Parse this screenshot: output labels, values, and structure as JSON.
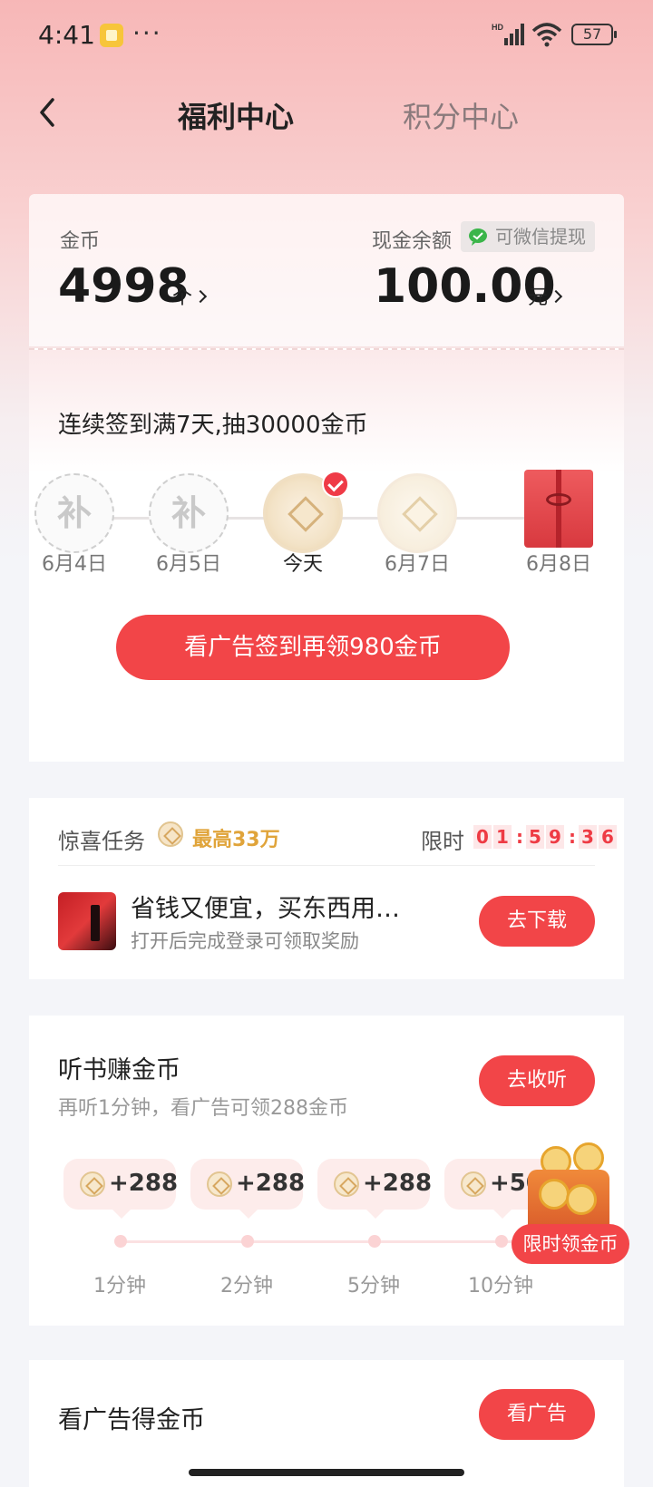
{
  "status_bar": {
    "time": "4:41",
    "more": "···",
    "battery": "57"
  },
  "header": {
    "tabs": [
      {
        "label": "福利中心",
        "active": true
      },
      {
        "label": "积分中心",
        "active": false
      }
    ]
  },
  "balance": {
    "coin_label": "金币",
    "coin_value": "4998",
    "coin_unit": "个",
    "cash_label": "现金余额",
    "wechat_badge": "可微信提现",
    "cash_value": "100.00",
    "cash_unit": "元"
  },
  "checkin": {
    "title": "连续签到满7天,抽30000金币",
    "days": [
      {
        "label": "6月4日",
        "state": "makeup",
        "glyph": "补"
      },
      {
        "label": "6月5日",
        "state": "makeup",
        "glyph": "补"
      },
      {
        "label": "今天",
        "state": "checked"
      },
      {
        "label": "6月7日",
        "state": "upcoming"
      },
      {
        "label": "6月8日",
        "state": "gift"
      }
    ],
    "button": "看广告签到再领980金币"
  },
  "surprise_task": {
    "title": "惊喜任务",
    "max_reward": "最高33万",
    "limit_label": "限时",
    "timer": [
      "0",
      "1",
      "5",
      "9",
      "3",
      "6"
    ],
    "headline": "省钱又便宜，买东西用…",
    "subtitle": "打开后完成登录可领取奖励",
    "button": "去下载"
  },
  "listen": {
    "title": "听书赚金币",
    "subtitle": "再听1分钟，看广告可领288金币",
    "button": "去收听",
    "rewards": [
      "+288",
      "+288",
      "+288",
      "+500"
    ],
    "minutes": [
      "1分钟",
      "2分钟",
      "5分钟",
      "10分钟"
    ]
  },
  "promo": {
    "label": "限时领金币"
  },
  "ad": {
    "title": "看广告得金币",
    "button": "看广告"
  },
  "colors": {
    "accent": "#f24548",
    "gold": "#e0a43a",
    "top_gradient": "#f7b7b7"
  }
}
